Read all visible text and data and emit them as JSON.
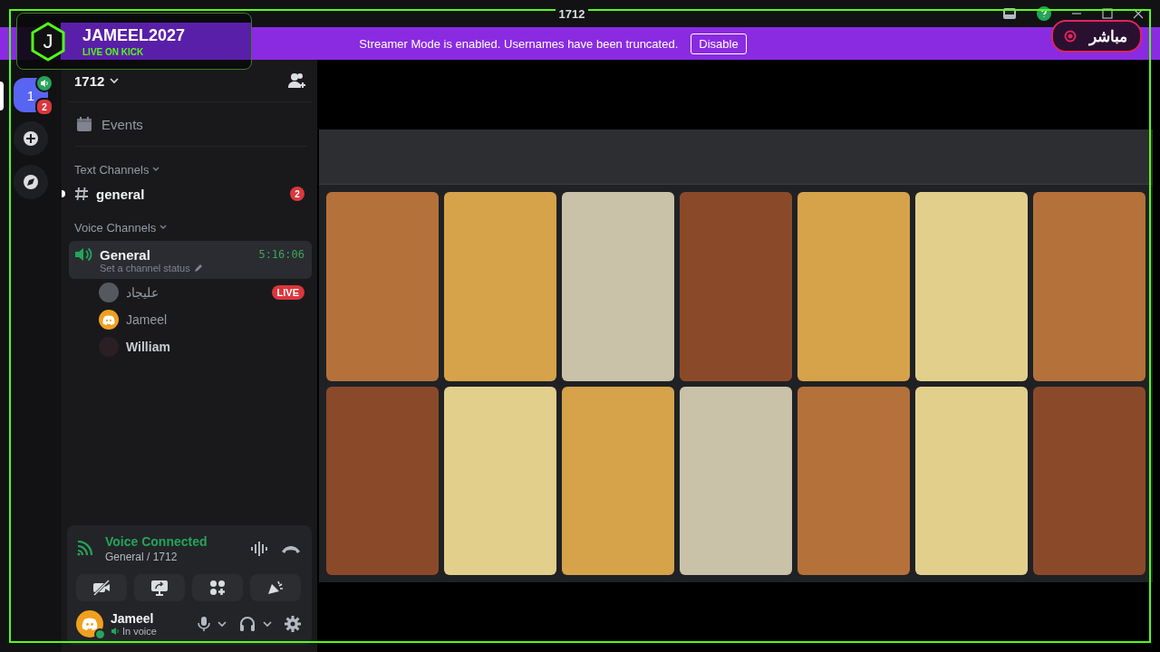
{
  "title_bar": {
    "title": "1712"
  },
  "banner": {
    "message": "Streamer Mode is enabled. Usernames have been truncated.",
    "button": "Disable"
  },
  "servers": [
    {
      "kind": "server",
      "label": "1",
      "badge": "2",
      "selected": true
    },
    {
      "kind": "add",
      "selected": false
    },
    {
      "kind": "discover",
      "selected": false
    }
  ],
  "server": {
    "name": "1712"
  },
  "events": {
    "label": "Events"
  },
  "text_category": {
    "label": "Text Channels",
    "expanded": true
  },
  "text_channels": [
    {
      "name": "general",
      "unread": true,
      "badge": "2"
    }
  ],
  "voice_category": {
    "label": "Voice Channels",
    "expanded": true
  },
  "voice_channels": [
    {
      "name": "General",
      "status_placeholder": "Set a channel status",
      "timer": "5:16:06",
      "selected": true,
      "members": [
        {
          "name": "عليجاد",
          "live": true,
          "live_label": "LIVE",
          "kind": "photo",
          "bright": false
        },
        {
          "name": "Jameel",
          "live": false,
          "kind": "logo",
          "bright": false
        },
        {
          "name": "William",
          "live": false,
          "kind": "dark",
          "bright": true
        }
      ]
    }
  ],
  "voice_panel": {
    "status": "Voice Connected",
    "channel": "General / 1712"
  },
  "user": {
    "name": "Jameel",
    "status": "In voice"
  },
  "overlay": {
    "initial": "J",
    "name": "JAMEEL2027",
    "subtitle": "LIVE ON KICK"
  },
  "live_badge": {
    "label": "مباشر"
  }
}
